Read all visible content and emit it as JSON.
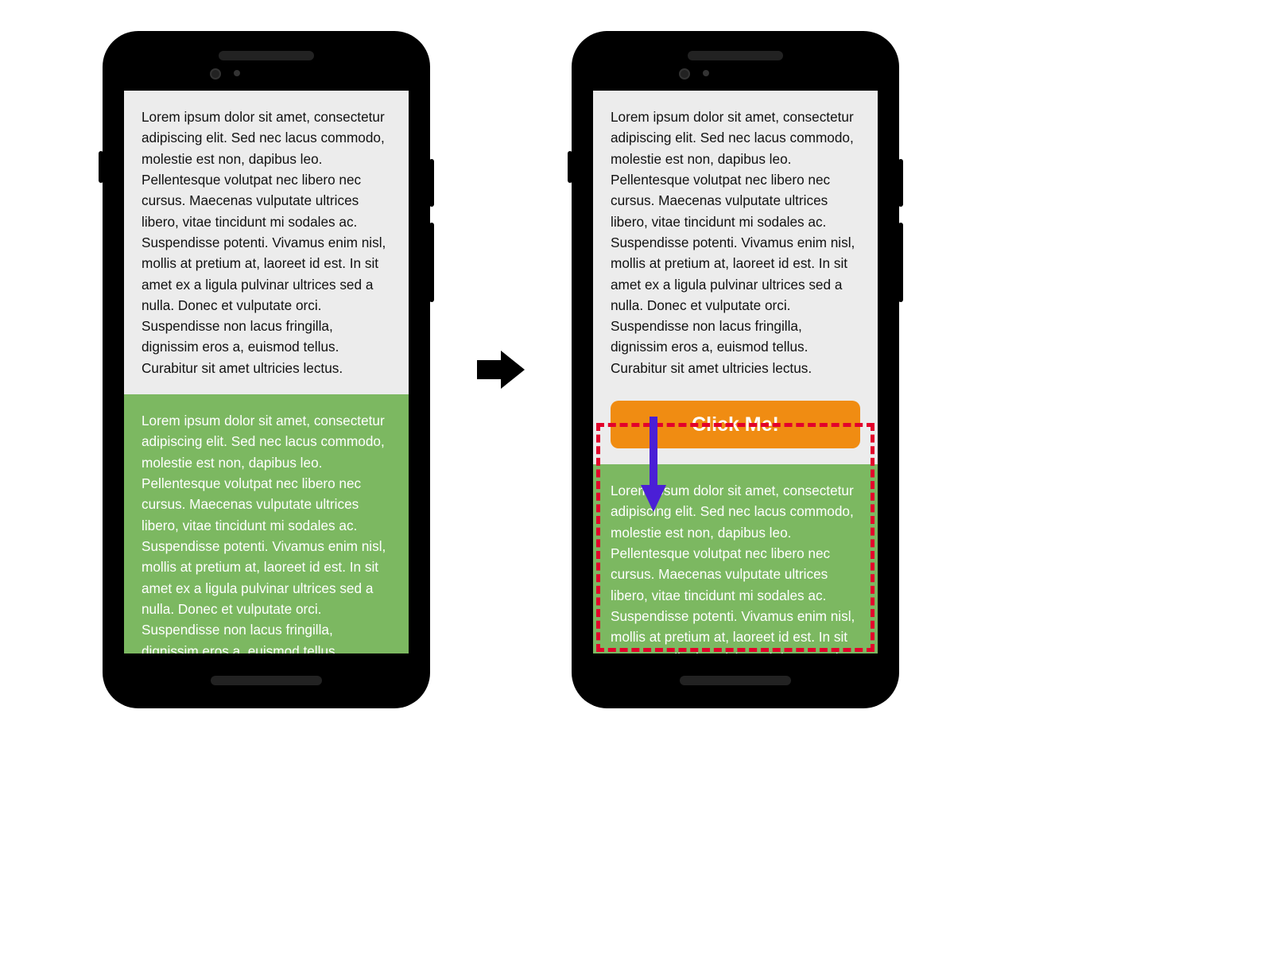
{
  "colors": {
    "phone_body": "#000000",
    "screen_bg": "#ececec",
    "green_panel": "#7cb861",
    "cta_bg": "#f08c12",
    "dashed_border": "#e3002b",
    "down_arrow": "#4a1fd6",
    "transition_arrow": "#000000"
  },
  "phone_left": {
    "top_text": "Lorem ipsum dolor sit amet, consectetur adipiscing elit. Sed nec lacus commodo, molestie est non, dapibus leo. Pellentesque volutpat nec libero nec cursus. Maecenas vulputate ultrices libero, vitae tincidunt mi sodales ac. Suspendisse potenti. Vivamus enim nisl, mollis at pretium at, laoreet id est. In sit amet ex a ligula pulvinar ultrices sed a nulla. Donec et vulputate orci. Suspendisse non lacus fringilla, dignissim eros a, euismod tellus. Curabitur sit amet ultricies lectus.",
    "green_text": "Lorem ipsum dolor sit amet, consectetur adipiscing elit. Sed nec lacus commodo, molestie est non, dapibus leo. Pellentesque volutpat nec libero nec cursus. Maecenas vulputate ultrices libero, vitae tincidunt mi sodales ac. Suspendisse potenti. Vivamus enim nisl, mollis at pretium at, laoreet id est. In sit amet ex a ligula pulvinar ultrices sed a nulla. Donec et vulputate orci. Suspendisse non lacus fringilla, dignissim eros a, euismod tellus. Curabitur sit amet ultricies lectus."
  },
  "phone_right": {
    "top_text": "Lorem ipsum dolor sit amet, consectetur adipiscing elit. Sed nec lacus commodo, molestie est non, dapibus leo. Pellentesque volutpat nec libero nec cursus. Maecenas vulputate ultrices libero, vitae tincidunt mi sodales ac. Suspendisse potenti. Vivamus enim nisl, mollis at pretium at, laoreet id est. In sit amet ex a ligula pulvinar ultrices sed a nulla. Donec et vulputate orci. Suspendisse non lacus fringilla, dignissim eros a, euismod tellus. Curabitur sit amet ultricies lectus.",
    "cta_label": "Click Me!",
    "green_text": "Lorem ipsum dolor sit amet, consectetur adipiscing elit. Sed nec lacus commodo, molestie est non, dapibus leo. Pellentesque volutpat nec libero nec cursus. Maecenas vulputate ultrices libero, vitae tincidunt mi sodales ac. Suspendisse potenti. Vivamus enim nisl, mollis at pretium at, laoreet id est. In sit amet ex a ligula pulvinar ultrices seed."
  }
}
